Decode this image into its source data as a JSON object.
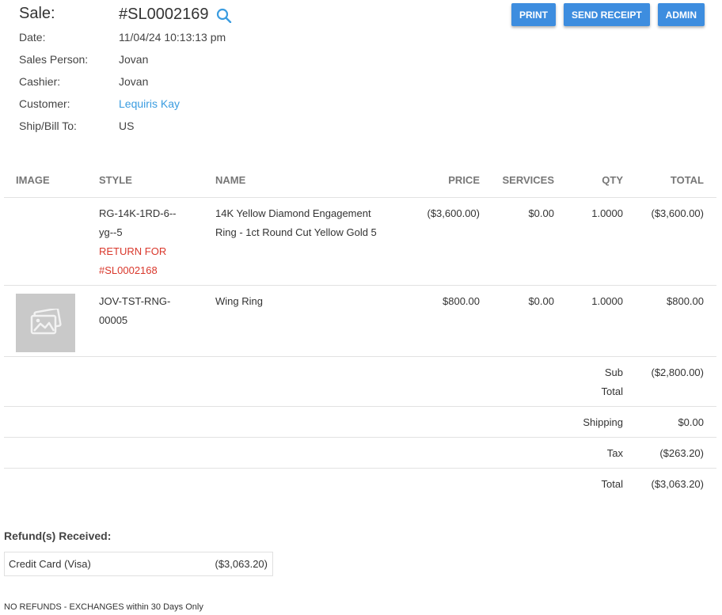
{
  "sale": {
    "title_label": "Sale:",
    "number": "#SL0002169",
    "fields": [
      {
        "label": "Date:",
        "value": "11/04/24 10:13:13 pm",
        "link": false
      },
      {
        "label": "Sales Person:",
        "value": "Jovan",
        "link": false
      },
      {
        "label": "Cashier:",
        "value": "Jovan",
        "link": false
      },
      {
        "label": "Customer:",
        "value": "Lequiris Kay",
        "link": true
      },
      {
        "label": "Ship/Bill To:",
        "value": "US",
        "link": false
      }
    ]
  },
  "actions": {
    "print": "PRINT",
    "send_receipt": "SEND RECEIPT",
    "admin": "ADMIN"
  },
  "table": {
    "headers": {
      "image": "IMAGE",
      "style": "STYLE",
      "name": "NAME",
      "price": "PRICE",
      "services": "SERVICES",
      "qty": "QTY",
      "total": "TOTAL"
    },
    "rows": [
      {
        "style_line1": "RG-14K-1RD-6--",
        "style_line2": "yg--5",
        "return_line1": "RETURN FOR",
        "return_line2": "#SL0002168",
        "name_line1": "14K Yellow Diamond Engagement",
        "name_line2": "Ring - 1ct Round Cut Yellow Gold 5",
        "price": "($3,600.00)",
        "services": "$0.00",
        "qty": "1.0000",
        "total": "($3,600.00)",
        "has_image": false
      },
      {
        "style_line1": "JOV-TST-RNG-",
        "style_line2": "00005",
        "name_line1": "Wing Ring",
        "price": "$800.00",
        "services": "$0.00",
        "qty": "1.0000",
        "total": "$800.00",
        "has_image": true,
        "image_icon": "image-placeholder-icon"
      }
    ],
    "summary": {
      "subtotal_label_1": "Sub",
      "subtotal_label_2": "Total",
      "subtotal": "($2,800.00)",
      "shipping_label": "Shipping",
      "shipping": "$0.00",
      "tax_label": "Tax",
      "tax": "($263.20)",
      "total_label": "Total",
      "total": "($3,063.20)"
    }
  },
  "refunds": {
    "title": "Refund(s) Received:",
    "items": [
      {
        "method": "Credit Card (Visa)",
        "amount": "($3,063.20)"
      }
    ]
  },
  "policy": "NO REFUNDS - EXCHANGES within 30 Days Only",
  "colors": {
    "accent": "#3d8ddf",
    "link": "#3a9ce0",
    "return_text": "#d9372b"
  }
}
